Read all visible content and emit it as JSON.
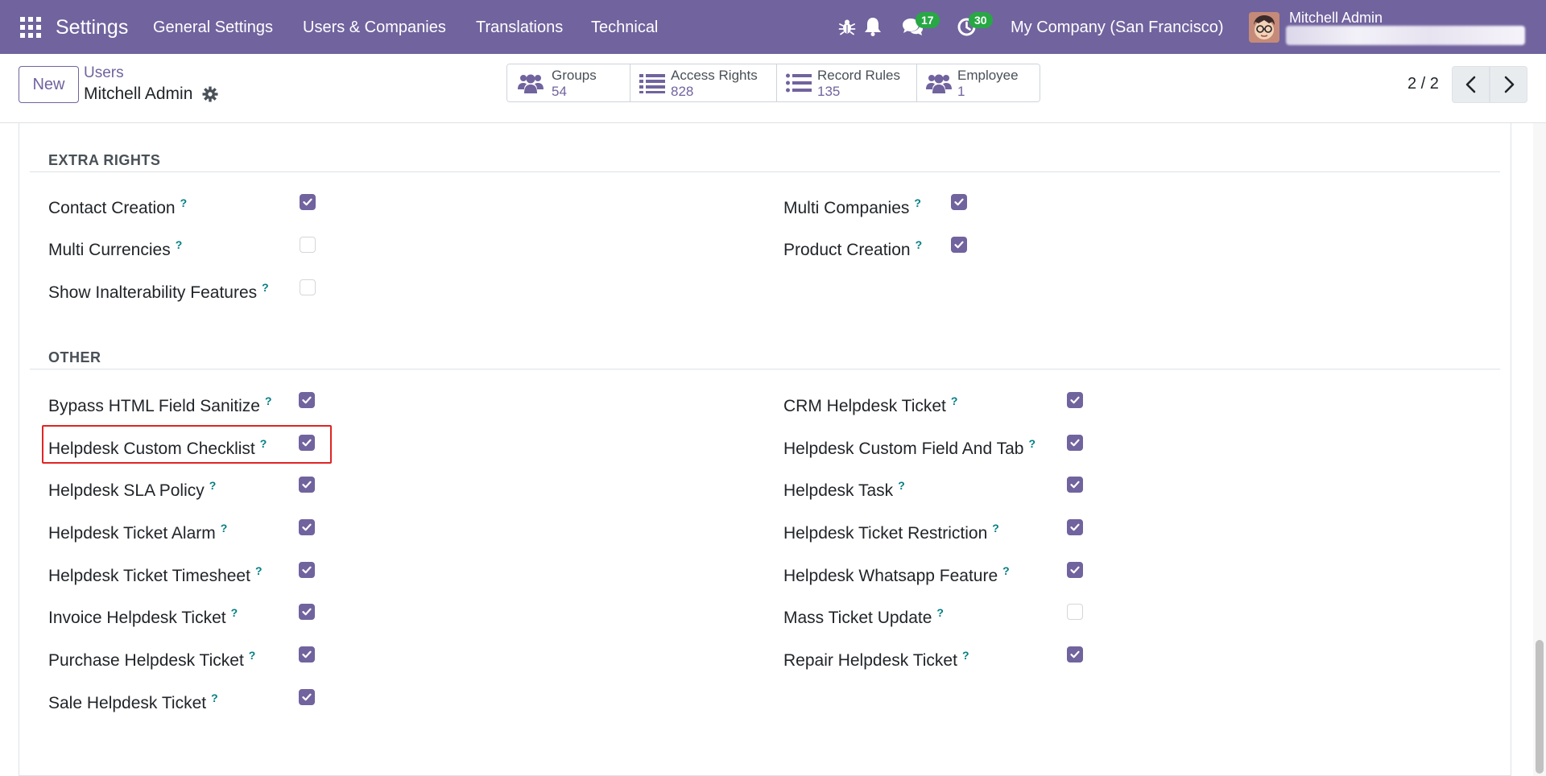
{
  "navbar": {
    "app_name": "Settings",
    "menu": [
      "General Settings",
      "Users & Companies",
      "Translations",
      "Technical"
    ],
    "discuss_count": "17",
    "activity_count": "30",
    "company": "My Company (San Francisco)",
    "user_name": "Mitchell Admin",
    "colors": {
      "bg": "#71639e",
      "badge": "#28a745"
    }
  },
  "control_panel": {
    "new_label": "New",
    "breadcrumb_parent": "Users",
    "breadcrumb_current": "Mitchell Admin",
    "smart_buttons": [
      {
        "label": "Groups",
        "value": "54",
        "icon": "users-icon"
      },
      {
        "label": "Access Rights",
        "value": "828",
        "icon": "list-icon"
      },
      {
        "label": "Record Rules",
        "value": "135",
        "icon": "list-icon"
      },
      {
        "label": "Employee",
        "value": "1",
        "icon": "users-icon"
      }
    ],
    "pager": "2 / 2"
  },
  "sections": {
    "extra_rights": {
      "title": "EXTRA RIGHTS",
      "fields": [
        {
          "label": "Contact Creation",
          "checked": true
        },
        {
          "label": "Multi Companies",
          "checked": true
        },
        {
          "label": "Multi Currencies",
          "checked": false
        },
        {
          "label": "Product Creation",
          "checked": true
        },
        {
          "label": "Show Inalterability Features",
          "checked": false
        }
      ]
    },
    "other": {
      "title": "OTHER",
      "fields": [
        {
          "label": "Bypass HTML Field Sanitize",
          "checked": true
        },
        {
          "label": "CRM Helpdesk Ticket",
          "checked": true
        },
        {
          "label": "Helpdesk Custom Checklist",
          "checked": true
        },
        {
          "label": "Helpdesk Custom Field And Tab",
          "checked": true
        },
        {
          "label": "Helpdesk SLA Policy",
          "checked": true
        },
        {
          "label": "Helpdesk Task",
          "checked": true
        },
        {
          "label": "Helpdesk Ticket Alarm",
          "checked": true
        },
        {
          "label": "Helpdesk Ticket Restriction",
          "checked": true
        },
        {
          "label": "Helpdesk Ticket Timesheet",
          "checked": true
        },
        {
          "label": "Helpdesk Whatsapp Feature",
          "checked": true
        },
        {
          "label": "Invoice Helpdesk Ticket",
          "checked": true
        },
        {
          "label": "Mass Ticket Update",
          "checked": false
        },
        {
          "label": "Purchase Helpdesk Ticket",
          "checked": true
        },
        {
          "label": "Repair Helpdesk Ticket",
          "checked": true
        },
        {
          "label": "Sale Helpdesk Ticket",
          "checked": true
        }
      ]
    }
  },
  "help_marker": "?",
  "colors": {
    "accent": "#71639e",
    "help": "#017e84",
    "highlight": "#e02424"
  }
}
